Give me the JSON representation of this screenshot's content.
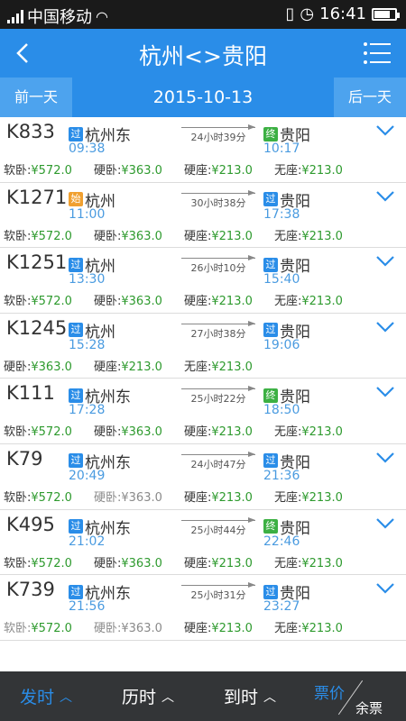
{
  "status_bar": {
    "carrier": "中国移动",
    "time": "16:41"
  },
  "header": {
    "title": "杭州<>贵阳"
  },
  "date_bar": {
    "prev_label": "前一天",
    "date": "2015-10-13",
    "next_label": "后一天"
  },
  "badges": {
    "pass": "过",
    "start": "始",
    "end": "终"
  },
  "trains": [
    {
      "number": "K833",
      "from_badge": "过",
      "from": "杭州东",
      "dep_time": "09:38",
      "duration": "24小时39分",
      "to_badge": "终",
      "to": "贵阳",
      "arr_time": "10:17",
      "seats": [
        {
          "label": "软卧:",
          "price": "¥572.0"
        },
        {
          "label": "硬卧:",
          "price": "¥363.0"
        },
        {
          "label": "硬座:",
          "price": "¥213.0"
        },
        {
          "label": "无座:",
          "price": "¥213.0"
        }
      ]
    },
    {
      "number": "K1271",
      "from_badge": "始",
      "from": "杭州",
      "dep_time": "11:00",
      "duration": "30小时38分",
      "to_badge": "过",
      "to": "贵阳",
      "arr_time": "17:38",
      "seats": [
        {
          "label": "软卧:",
          "price": "¥572.0"
        },
        {
          "label": "硬卧:",
          "price": "¥363.0"
        },
        {
          "label": "硬座:",
          "price": "¥213.0"
        },
        {
          "label": "无座:",
          "price": "¥213.0"
        }
      ]
    },
    {
      "number": "K1251",
      "from_badge": "过",
      "from": "杭州",
      "dep_time": "13:30",
      "duration": "26小时10分",
      "to_badge": "过",
      "to": "贵阳",
      "arr_time": "15:40",
      "seats": [
        {
          "label": "软卧:",
          "price": "¥572.0"
        },
        {
          "label": "硬卧:",
          "price": "¥363.0"
        },
        {
          "label": "硬座:",
          "price": "¥213.0"
        },
        {
          "label": "无座:",
          "price": "¥213.0"
        }
      ]
    },
    {
      "number": "K1245",
      "from_badge": "过",
      "from": "杭州",
      "dep_time": "15:28",
      "duration": "27小时38分",
      "to_badge": "过",
      "to": "贵阳",
      "arr_time": "19:06",
      "seats": [
        {
          "label": "硬卧:",
          "price": "¥363.0"
        },
        {
          "label": "硬座:",
          "price": "¥213.0"
        },
        {
          "label": "无座:",
          "price": "¥213.0"
        }
      ]
    },
    {
      "number": "K111",
      "from_badge": "过",
      "from": "杭州东",
      "dep_time": "17:28",
      "duration": "25小时22分",
      "to_badge": "终",
      "to": "贵阳",
      "arr_time": "18:50",
      "seats": [
        {
          "label": "软卧:",
          "price": "¥572.0"
        },
        {
          "label": "硬卧:",
          "price": "¥363.0"
        },
        {
          "label": "硬座:",
          "price": "¥213.0"
        },
        {
          "label": "无座:",
          "price": "¥213.0"
        }
      ]
    },
    {
      "number": "K79",
      "from_badge": "过",
      "from": "杭州东",
      "dep_time": "20:49",
      "duration": "24小时47分",
      "to_badge": "过",
      "to": "贵阳",
      "arr_time": "21:36",
      "seats": [
        {
          "label": "软卧:",
          "price": "¥572.0"
        },
        {
          "label": "硬卧:",
          "price": "¥363.0",
          "dim": true
        },
        {
          "label": "硬座:",
          "price": "¥213.0"
        },
        {
          "label": "无座:",
          "price": "¥213.0"
        }
      ]
    },
    {
      "number": "K495",
      "from_badge": "过",
      "from": "杭州东",
      "dep_time": "21:02",
      "duration": "25小时44分",
      "to_badge": "终",
      "to": "贵阳",
      "arr_time": "22:46",
      "seats": [
        {
          "label": "软卧:",
          "price": "¥572.0"
        },
        {
          "label": "硬卧:",
          "price": "¥363.0"
        },
        {
          "label": "硬座:",
          "price": "¥213.0"
        },
        {
          "label": "无座:",
          "price": "¥213.0"
        }
      ]
    },
    {
      "number": "K739",
      "from_badge": "过",
      "from": "杭州东",
      "dep_time": "21:56",
      "duration": "25小时31分",
      "to_badge": "过",
      "to": "贵阳",
      "arr_time": "23:27",
      "seats": [
        {
          "label": "软卧:",
          "price": "¥572.0",
          "dim_label": true
        },
        {
          "label": "硬卧:",
          "price": "¥363.0",
          "dim": true
        },
        {
          "label": "硬座:",
          "price": "¥213.0"
        },
        {
          "label": "无座:",
          "price": "¥213.0"
        }
      ]
    }
  ],
  "bottom_bar": {
    "tabs": [
      {
        "label": "发时",
        "active": true
      },
      {
        "label": "历时"
      },
      {
        "label": "到时"
      }
    ],
    "price_label": "票价",
    "remaining_label": "余票",
    "arrow": "^"
  },
  "colors": {
    "accent": "#2a8de8",
    "price_green": "#2e9a2e",
    "bottom_bg": "#333537"
  }
}
